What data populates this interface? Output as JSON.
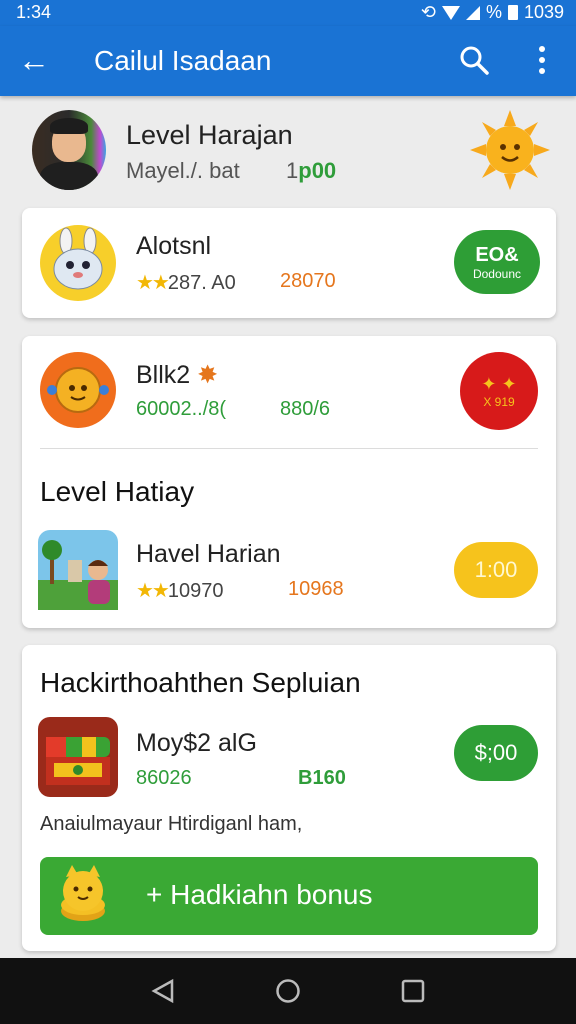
{
  "status": {
    "time": "1:34",
    "percent": "%",
    "clock": "1039"
  },
  "appbar": {
    "title": "Cailul Isadaan",
    "back_icon": "arrow-left-icon",
    "search_icon": "search-icon",
    "more_icon": "more-vert-icon"
  },
  "profile": {
    "name": "Level Harajan",
    "sub": "Mayel./. bat",
    "points_prefix": "1",
    "points": "p00"
  },
  "items": [
    {
      "name": "Alotsnl",
      "stars": "★★",
      "stat1": "287. A0",
      "stat2": "28070",
      "button_top": "EO&",
      "button_bottom": "Dodounc"
    },
    {
      "name": "Bllk2",
      "stat1": "60002../8(",
      "stat2": "880/6",
      "button_text": "X 919"
    }
  ],
  "section1": {
    "title": "Level Hatiay",
    "item": {
      "name": "Havel Harian",
      "stars": "★★",
      "stat1": "10970",
      "stat2": "10968",
      "button": "1:00"
    }
  },
  "section2": {
    "title": "Hackirthoahthen Sepluian",
    "item": {
      "name": "Moy$2 alG",
      "stat1": "86026",
      "stat2": "B160",
      "button": "$;00"
    },
    "note": "Anaiulmayaur Htirdiganl ham,",
    "bonus": "+ Hadkiahn bonus"
  },
  "colors": {
    "appbar": "#1a73d4",
    "green": "#2e9e36",
    "orange": "#e5761d",
    "red": "#d71a1a",
    "yellow": "#f6c31c"
  }
}
